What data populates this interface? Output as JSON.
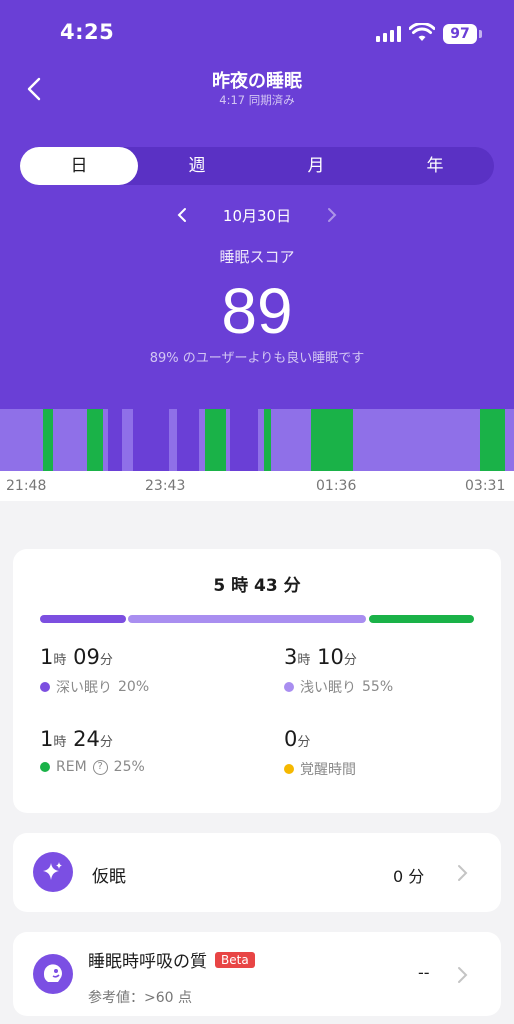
{
  "status_bar": {
    "time": "4:25",
    "battery": "97"
  },
  "header": {
    "title": "昨夜の睡眠",
    "subtitle": "4:17 同期済み"
  },
  "tabs": [
    {
      "label": "日",
      "active": true
    },
    {
      "label": "週",
      "active": false
    },
    {
      "label": "月",
      "active": false
    },
    {
      "label": "年",
      "active": false
    }
  ],
  "date": "10月30日",
  "score": {
    "label": "睡眠スコア",
    "value": "89",
    "description": "89% のユーザーよりも良い睡眠です"
  },
  "hypnogram": {
    "colors": {
      "deep": "#6a3fd6",
      "light": "#8f70e8",
      "rem": "#1ab248"
    },
    "time_labels": [
      "21:48",
      "23:43",
      "01:36",
      "03:31"
    ]
  },
  "summary": {
    "total": "5 時 43 分",
    "stages": [
      {
        "name": "深い眠り",
        "hours": "1",
        "hours_unit": "時",
        "minutes": "09",
        "minutes_unit": "分",
        "percent": "20%",
        "color": "#7c4fe0"
      },
      {
        "name": "浅い眠り",
        "hours": "3",
        "hours_unit": "時",
        "minutes": "10",
        "minutes_unit": "分",
        "percent": "55%",
        "color": "#a98ef0"
      },
      {
        "name": "REM",
        "hours": "1",
        "hours_unit": "時",
        "minutes": "24",
        "minutes_unit": "分",
        "percent": "25%",
        "color": "#1ab248"
      },
      {
        "name": "覚醒時間",
        "minutes": "0",
        "minutes_unit": "分",
        "color": "#f5b800"
      }
    ]
  },
  "nap": {
    "title": "仮眠",
    "value": "0 分"
  },
  "breathing": {
    "title": "睡眠時呼吸の質",
    "badge": "Beta",
    "reference": "参考値：>60 点",
    "value": "--"
  }
}
